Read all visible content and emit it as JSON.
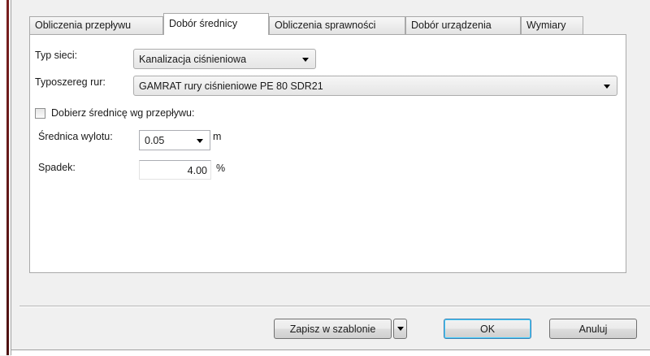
{
  "tabs": [
    {
      "label": "Obliczenia przepływu"
    },
    {
      "label": "Dobór średnicy",
      "active": true
    },
    {
      "label": "Obliczenia sprawności"
    },
    {
      "label": "Dobór urządzenia"
    },
    {
      "label": "Wymiary"
    }
  ],
  "form": {
    "network_type_label": "Typ sieci:",
    "network_type_value": "Kanalizacja ciśnieniowa",
    "pipe_series_label": "Typoszereg rur:",
    "pipe_series_value": "GAMRAT rury ciśnieniowe PE 80 SDR21",
    "flow_checkbox_label": "Dobierz średnicę wg przepływu:",
    "flow_checkbox_checked": false,
    "outlet_diameter_label": "Średnica wylotu:",
    "outlet_diameter_value": "0.05",
    "outlet_diameter_unit": "m",
    "slope_label": "Spadek:",
    "slope_value": "4.00",
    "slope_unit": "%"
  },
  "footer": {
    "save_template_label": "Zapisz w szablonie",
    "ok_label": "OK",
    "cancel_label": "Anuluj"
  },
  "icons": {
    "dropdown": "chevron-down-icon"
  },
  "colors": {
    "window_border": "#6b1a1a",
    "default_button_border": "#3c7fb1"
  }
}
